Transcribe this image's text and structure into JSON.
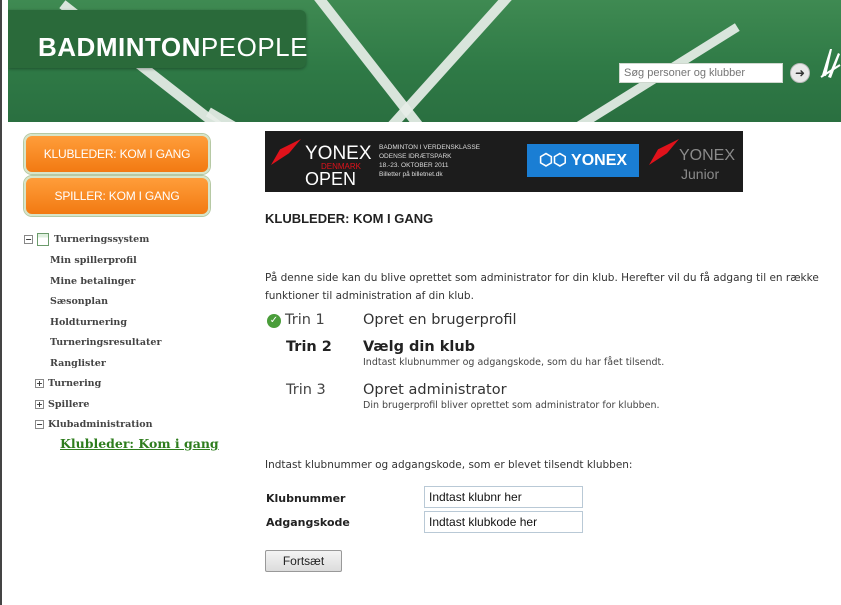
{
  "header": {
    "logo_bold": "BADMINTON",
    "logo_light": "PEOPLE",
    "search_placeholder": "Søg personer og klubber",
    "search_button_icon": "arrow-right-icon"
  },
  "sidebar": {
    "buttons": [
      {
        "label": "KLUBLEDER: KOM I GANG"
      },
      {
        "label": "SPILLER: KOM I GANG"
      }
    ],
    "tree": {
      "root": "Turneringssystem",
      "items": [
        "Min spillerprofil",
        "Mine betalinger",
        "Sæsonplan",
        "Holdturnering",
        "Turneringsresultater",
        "Ranglister"
      ],
      "groups": [
        {
          "label": "Turnering",
          "toggle": "+"
        },
        {
          "label": "Spillere",
          "toggle": "+"
        },
        {
          "label": "Klubadministration",
          "toggle": "−"
        }
      ],
      "active_link": "Klubleder: Kom i gang"
    }
  },
  "banner": {
    "yonex": "YONEX",
    "denmark": "DENMARK",
    "open": "OPEN",
    "line1": "BADMINTON I VERDENSKLASSE",
    "line2": "ODENSE IDRÆTSPARK",
    "line3": "18.-23. OKTOBER 2011",
    "line4": "Billetter på billetnet.dk",
    "center_logo": "YONEX",
    "right_yonex": "YONEX",
    "right_junior": "Junior"
  },
  "main": {
    "title": "KLUBLEDER: KOM I GANG",
    "intro": "På denne side kan du blive oprettet som administrator for din klub. Herefter vil du få adgang til en række funktioner til administration af din klub.",
    "steps": [
      {
        "label": "Trin 1",
        "title": "Opret en brugerprofil",
        "desc": "",
        "done": true
      },
      {
        "label": "Trin 2",
        "title": "Vælg din klub",
        "desc": "Indtast klubnummer og adgangskode, som du har fået tilsendt.",
        "current": true
      },
      {
        "label": "Trin 3",
        "title": "Opret administrator",
        "desc": "Din brugerprofil bliver oprettet som administrator for klubben."
      }
    ],
    "instruction": "Indtast klubnummer og adgangskode, som er blevet tilsendt klubben:",
    "form": {
      "club_label": "Klubnummer",
      "club_value": "Indtast klubnr her",
      "code_label": "Adgangskode",
      "code_value": "Indtast klubkode her",
      "submit": "Fortsæt"
    }
  },
  "colors": {
    "header_green": "#2f7a46",
    "orange": "#f27a12",
    "link_green": "#2e7d1d",
    "yonex_red": "#e0121b",
    "yonex_blue": "#1a7ed4"
  }
}
